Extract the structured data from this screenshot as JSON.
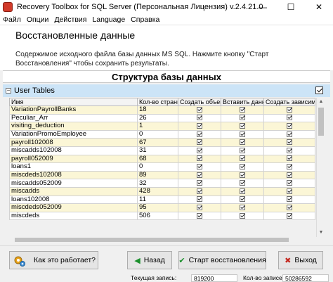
{
  "window": {
    "title": "Recovery Toolbox for SQL Server (Персональная Лицензия) v.2.4.21.0",
    "minimize": "—",
    "maximize": "☐",
    "close": "✕"
  },
  "menu": [
    "Файл",
    "Опции",
    "Действия",
    "Language",
    "Справка"
  ],
  "header": {
    "title": "Восстановленные данные",
    "description": "Содержимое исходного файла базы данных MS SQL. Нажмите кнопку \"Старт Восстановления\" чтобы сохранить результаты."
  },
  "section_title": "Структура базы данных",
  "group": {
    "toggle": "−",
    "label": "User Tables"
  },
  "table": {
    "columns": [
      "Имя",
      "Кол-во страниц",
      "Создать объект",
      "Вставить данны",
      "Создать зависимые"
    ],
    "rows": [
      {
        "name": "VariationPayrollBanks",
        "pages": "18"
      },
      {
        "name": "Peculiar_Arr",
        "pages": "26"
      },
      {
        "name": "visiting_deduction",
        "pages": "1"
      },
      {
        "name": "VariationPromoEmployee",
        "pages": "0"
      },
      {
        "name": "payroll102008",
        "pages": "67"
      },
      {
        "name": "miscadds102008",
        "pages": "31"
      },
      {
        "name": "payroll052009",
        "pages": "68"
      },
      {
        "name": "loans1",
        "pages": "0"
      },
      {
        "name": "miscdeds102008",
        "pages": "89"
      },
      {
        "name": "miscadds052009",
        "pages": "32"
      },
      {
        "name": "miscadds",
        "pages": "428"
      },
      {
        "name": "loans102008",
        "pages": "11"
      },
      {
        "name": "miscdeds052009",
        "pages": "95"
      },
      {
        "name": "miscdeds",
        "pages": "506"
      }
    ]
  },
  "buttons": {
    "help": "Как это работает?",
    "back": "Назад",
    "start": "Старт восстановления",
    "exit": "Выход"
  },
  "status": {
    "current_label": "Текущая запись:",
    "current_value": "819200",
    "count_label": "Кол-во записей:",
    "count_value": "50286592"
  },
  "colors": {
    "group_header": "#cce4f7",
    "row_alt": "#fbf6d6",
    "accent_green": "#1a8f2b",
    "accent_red": "#c4251c"
  }
}
